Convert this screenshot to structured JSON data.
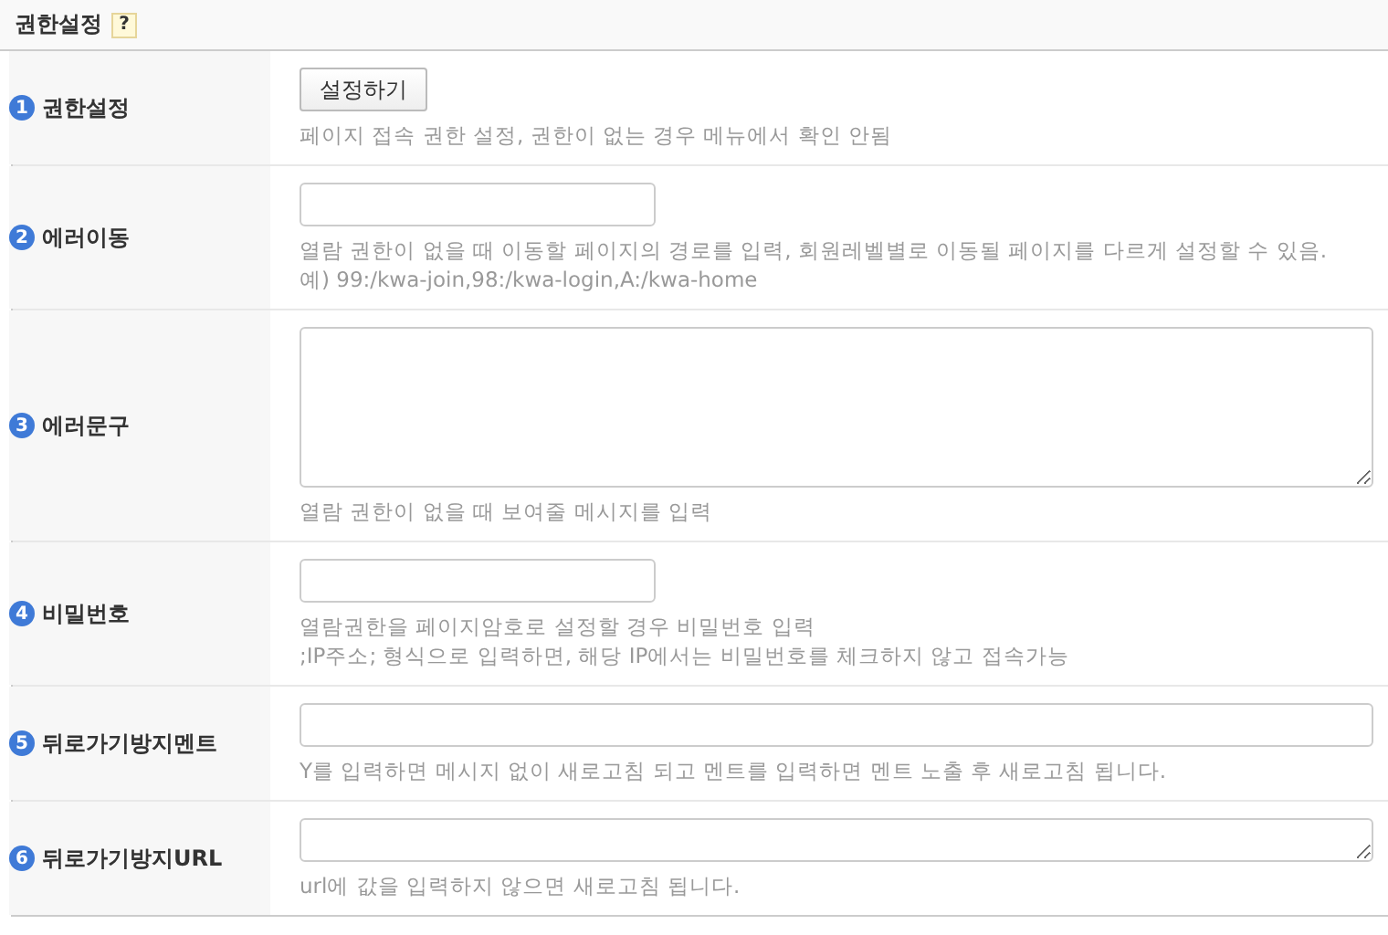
{
  "section": {
    "title": "권한설정",
    "help": "?"
  },
  "rows": [
    {
      "number": "1",
      "label": "권한설정",
      "field": {
        "kind": "button",
        "label": "설정하기"
      },
      "notes": [
        "페이지 접속 권한 설정, 권한이 없는 경우 메뉴에서 확인 안됨"
      ]
    },
    {
      "number": "2",
      "label": "에러이동",
      "field": {
        "kind": "short-input"
      },
      "notes": [
        "열람 권한이 없을 때 이동할 페이지의 경로를 입력, 회원레벨별로 이동될 페이지를 다르게 설정할 수 있음.",
        "예) 99:/kwa-join,98:/kwa-login,A:/kwa-home"
      ]
    },
    {
      "number": "3",
      "label": "에러문구",
      "field": {
        "kind": "big-textarea"
      },
      "notes": [
        "열람 권한이 없을 때 보여줄 메시지를 입력"
      ]
    },
    {
      "number": "4",
      "label": "비밀번호",
      "field": {
        "kind": "short-input"
      },
      "notes": [
        "열람권한을 페이지암호로 설정할 경우 비밀번호 입력",
        ";IP주소; 형식으로 입력하면, 해당 IP에서는 비밀번호를 체크하지 않고 접속가능"
      ]
    },
    {
      "number": "5",
      "label": "뒤로가기방지멘트",
      "field": {
        "kind": "long-input"
      },
      "notes": [
        "Y를 입력하면 메시지 없이 새로고침 되고 멘트를 입력하면 멘트 노출 후 새로고침 됩니다."
      ]
    },
    {
      "number": "6",
      "label": "뒤로가기방지URL",
      "field": {
        "kind": "small-textarea"
      },
      "notes": [
        "url에 값을 입력하지 않으면 새로고침 됩니다."
      ]
    }
  ]
}
